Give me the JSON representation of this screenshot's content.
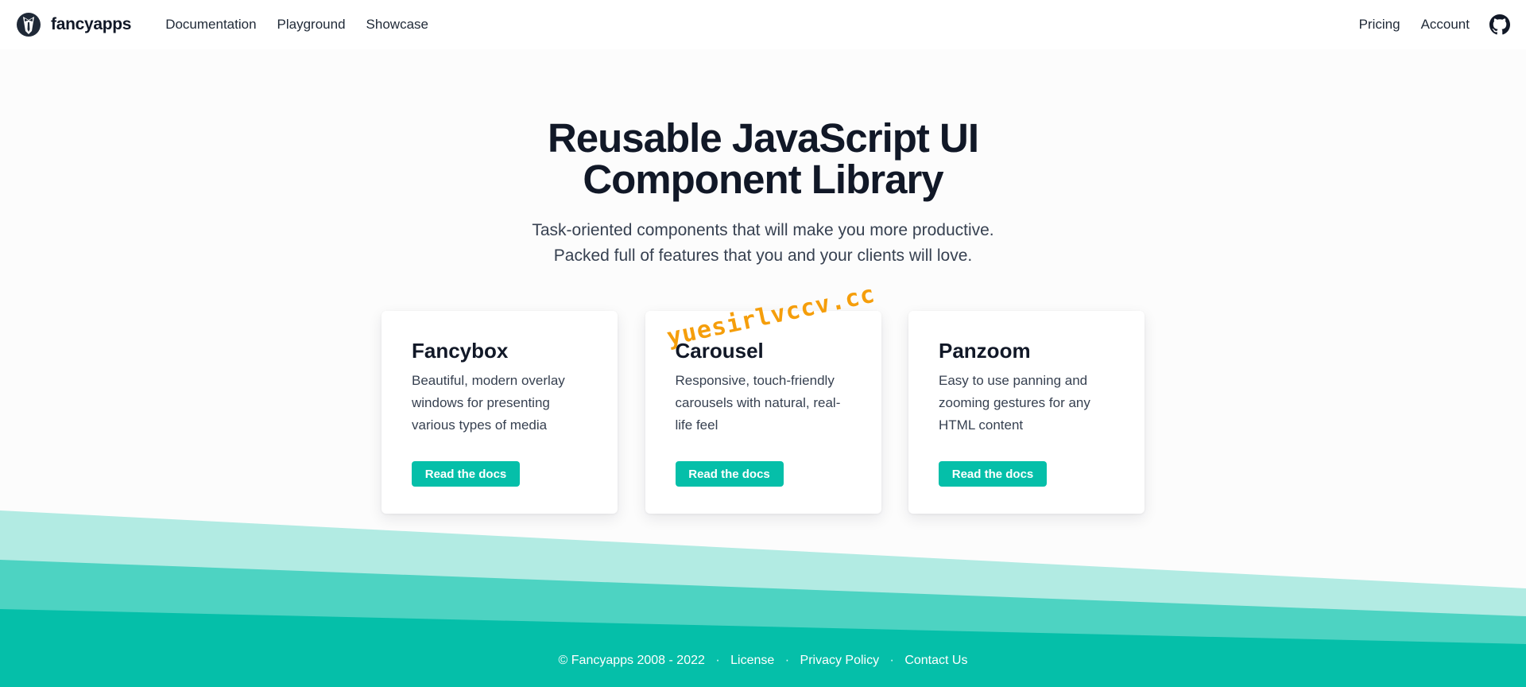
{
  "header": {
    "brand_name": "fancyapps",
    "nav_left": [
      "Documentation",
      "Playground",
      "Showcase"
    ],
    "nav_right": [
      "Pricing",
      "Account"
    ],
    "github_icon": "github-icon"
  },
  "hero": {
    "title_line1": "Reusable JavaScript UI",
    "title_line2": "Component Library",
    "subtitle_line1": "Task-oriented components that will make you more productive.",
    "subtitle_line2": "Packed full of features that you and your clients will love."
  },
  "cards": [
    {
      "title": "Fancybox",
      "description": "Beautiful, modern overlay windows for presenting various types of media",
      "button": "Read the docs"
    },
    {
      "title": "Carousel",
      "description": "Responsive, touch-friendly carousels with natural, real-life feel",
      "button": "Read the docs"
    },
    {
      "title": "Panzoom",
      "description": "Easy to use panning and zooming gestures for any HTML content",
      "button": "Read the docs"
    }
  ],
  "watermark": "yuesirlvccv.cc",
  "footer": {
    "copyright": "© Fancyapps 2008 - 2022",
    "sep": "·",
    "links": [
      "License",
      "Privacy Policy",
      "Contact Us"
    ]
  },
  "colors": {
    "accent": "#05bfa9",
    "wave_light": "#b2ebe3",
    "wave_mid": "#4dd3c2",
    "wave_dark": "#05bfa9",
    "text_dark": "#111827",
    "watermark": "#f59e0b"
  }
}
